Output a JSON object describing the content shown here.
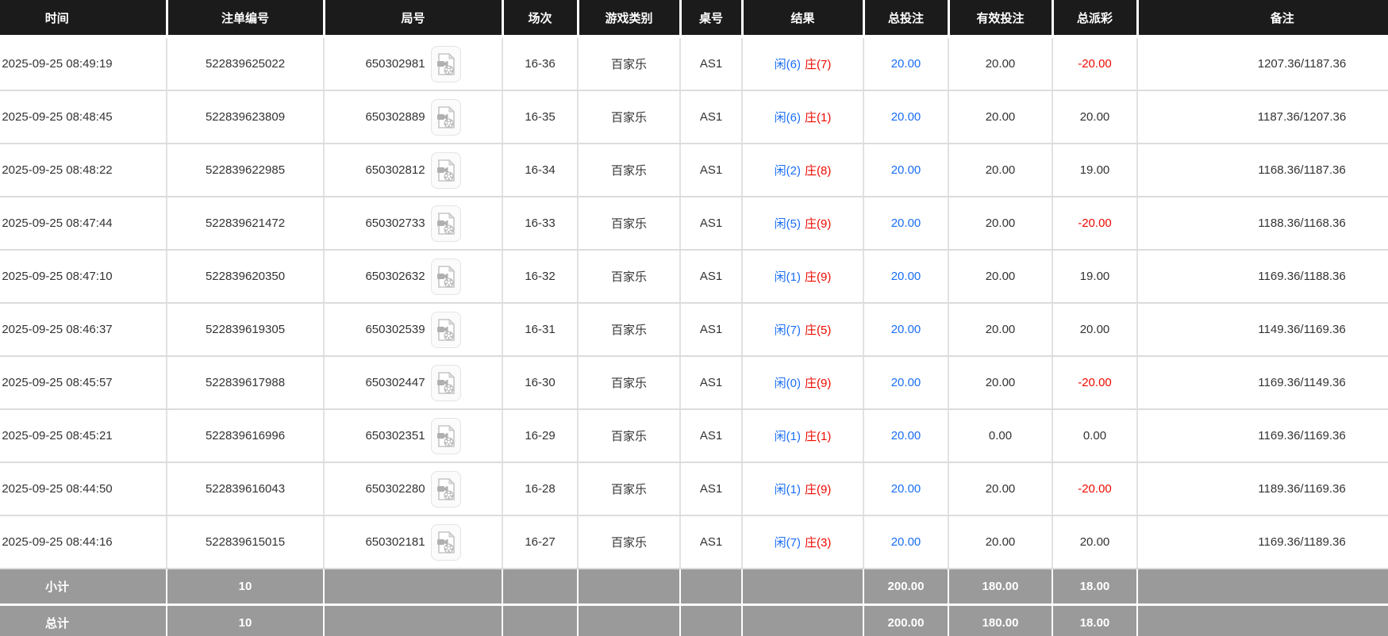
{
  "colors": {
    "header_bg": "#1b1b1b",
    "player_blue": "#1a6ef5",
    "banker_red": "#ee0a00",
    "bet_blue": "#1a6ef5",
    "negative_red": "#ee0a00",
    "summary_bg": "#9a9a9a"
  },
  "table": {
    "headers": [
      "时间",
      "注单编号",
      "局号",
      "场次",
      "游戏类别",
      "桌号",
      "结果",
      "总投注",
      "有效投注",
      "总派彩",
      "备注"
    ],
    "rows": [
      {
        "time": "2025-09-25 08:49:19",
        "bet_id": "522839625022",
        "round_no": "650302981",
        "session": "16-36",
        "game_type": "百家乐",
        "table_no": "AS1",
        "result_player": "闲(6)",
        "result_banker": "庄(7)",
        "total_bet": "20.00",
        "valid_bet": "20.00",
        "payout": "-20.00",
        "remark": "1207.36/1187.36"
      },
      {
        "time": "2025-09-25 08:48:45",
        "bet_id": "522839623809",
        "round_no": "650302889",
        "session": "16-35",
        "game_type": "百家乐",
        "table_no": "AS1",
        "result_player": "闲(6)",
        "result_banker": "庄(1)",
        "total_bet": "20.00",
        "valid_bet": "20.00",
        "payout": "20.00",
        "remark": "1187.36/1207.36"
      },
      {
        "time": "2025-09-25 08:48:22",
        "bet_id": "522839622985",
        "round_no": "650302812",
        "session": "16-34",
        "game_type": "百家乐",
        "table_no": "AS1",
        "result_player": "闲(2)",
        "result_banker": "庄(8)",
        "total_bet": "20.00",
        "valid_bet": "20.00",
        "payout": "19.00",
        "remark": "1168.36/1187.36"
      },
      {
        "time": "2025-09-25 08:47:44",
        "bet_id": "522839621472",
        "round_no": "650302733",
        "session": "16-33",
        "game_type": "百家乐",
        "table_no": "AS1",
        "result_player": "闲(5)",
        "result_banker": "庄(9)",
        "total_bet": "20.00",
        "valid_bet": "20.00",
        "payout": "-20.00",
        "remark": "1188.36/1168.36"
      },
      {
        "time": "2025-09-25 08:47:10",
        "bet_id": "522839620350",
        "round_no": "650302632",
        "session": "16-32",
        "game_type": "百家乐",
        "table_no": "AS1",
        "result_player": "闲(1)",
        "result_banker": "庄(9)",
        "total_bet": "20.00",
        "valid_bet": "20.00",
        "payout": "19.00",
        "remark": "1169.36/1188.36"
      },
      {
        "time": "2025-09-25 08:46:37",
        "bet_id": "522839619305",
        "round_no": "650302539",
        "session": "16-31",
        "game_type": "百家乐",
        "table_no": "AS1",
        "result_player": "闲(7)",
        "result_banker": "庄(5)",
        "total_bet": "20.00",
        "valid_bet": "20.00",
        "payout": "20.00",
        "remark": "1149.36/1169.36"
      },
      {
        "time": "2025-09-25 08:45:57",
        "bet_id": "522839617988",
        "round_no": "650302447",
        "session": "16-30",
        "game_type": "百家乐",
        "table_no": "AS1",
        "result_player": "闲(0)",
        "result_banker": "庄(9)",
        "total_bet": "20.00",
        "valid_bet": "20.00",
        "payout": "-20.00",
        "remark": "1169.36/1149.36"
      },
      {
        "time": "2025-09-25 08:45:21",
        "bet_id": "522839616996",
        "round_no": "650302351",
        "session": "16-29",
        "game_type": "百家乐",
        "table_no": "AS1",
        "result_player": "闲(1)",
        "result_banker": "庄(1)",
        "total_bet": "20.00",
        "valid_bet": "0.00",
        "payout": "0.00",
        "remark": "1169.36/1169.36"
      },
      {
        "time": "2025-09-25 08:44:50",
        "bet_id": "522839616043",
        "round_no": "650302280",
        "session": "16-28",
        "game_type": "百家乐",
        "table_no": "AS1",
        "result_player": "闲(1)",
        "result_banker": "庄(9)",
        "total_bet": "20.00",
        "valid_bet": "20.00",
        "payout": "-20.00",
        "remark": "1189.36/1169.36"
      },
      {
        "time": "2025-09-25 08:44:16",
        "bet_id": "522839615015",
        "round_no": "650302181",
        "session": "16-27",
        "game_type": "百家乐",
        "table_no": "AS1",
        "result_player": "闲(7)",
        "result_banker": "庄(3)",
        "total_bet": "20.00",
        "valid_bet": "20.00",
        "payout": "20.00",
        "remark": "1169.36/1189.36"
      }
    ],
    "subtotal": {
      "label": "小计",
      "count": "10",
      "total_bet": "200.00",
      "valid_bet": "180.00",
      "payout": "18.00"
    },
    "total": {
      "label": "总计",
      "count": "10",
      "total_bet": "200.00",
      "valid_bet": "180.00",
      "payout": "18.00"
    }
  }
}
